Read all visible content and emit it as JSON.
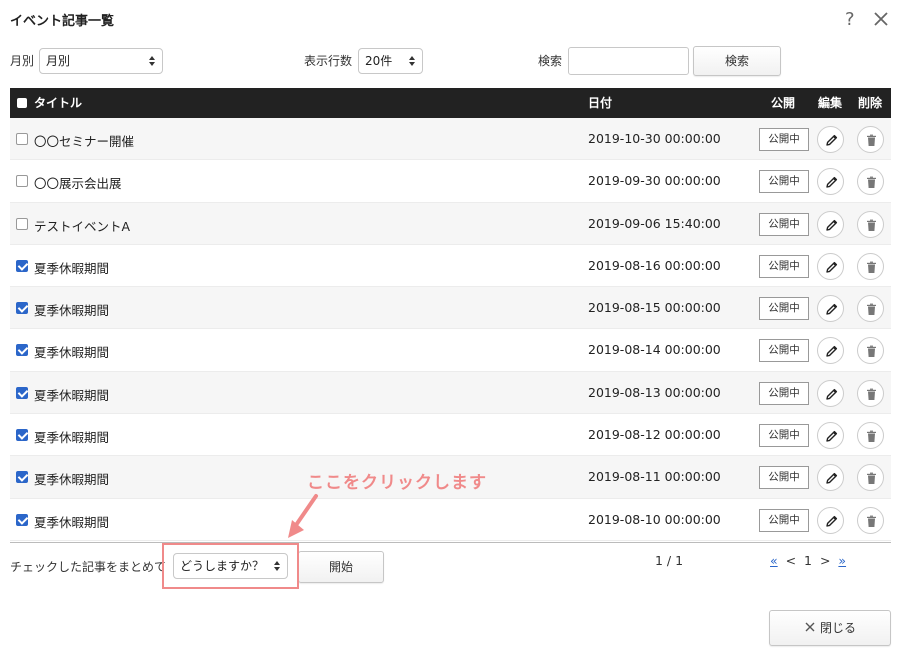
{
  "dialog": {
    "title": "イベント記事一覧",
    "help_glyph": "?",
    "close_icon": "close-x-icon"
  },
  "filters": {
    "month_label": "月別",
    "month_select_value": "月別",
    "rows_label": "表示行数",
    "rows_select_value": "20件",
    "search_label": "検索",
    "search_value": "",
    "search_button": "検索"
  },
  "table": {
    "headers": {
      "title": "タイトル",
      "date": "日付",
      "publish": "公開",
      "edit": "編集",
      "delete": "削除"
    },
    "rows": [
      {
        "title": "〇〇セミナー開催",
        "date": "2019-10-30 00:00:00",
        "checked": false,
        "status": "公開中"
      },
      {
        "title": "〇〇展示会出展",
        "date": "2019-09-30 00:00:00",
        "checked": false,
        "status": "公開中"
      },
      {
        "title": "テストイベントA",
        "date": "2019-09-06 15:40:00",
        "checked": false,
        "status": "公開中"
      },
      {
        "title": "夏季休暇期間",
        "date": "2019-08-16 00:00:00",
        "checked": true,
        "status": "公開中"
      },
      {
        "title": "夏季休暇期間",
        "date": "2019-08-15 00:00:00",
        "checked": true,
        "status": "公開中"
      },
      {
        "title": "夏季休暇期間",
        "date": "2019-08-14 00:00:00",
        "checked": true,
        "status": "公開中"
      },
      {
        "title": "夏季休暇期間",
        "date": "2019-08-13 00:00:00",
        "checked": true,
        "status": "公開中"
      },
      {
        "title": "夏季休暇期間",
        "date": "2019-08-12 00:00:00",
        "checked": true,
        "status": "公開中"
      },
      {
        "title": "夏季休暇期間",
        "date": "2019-08-11 00:00:00",
        "checked": true,
        "status": "公開中"
      },
      {
        "title": "夏季休暇期間",
        "date": "2019-08-10 00:00:00",
        "checked": true,
        "status": "公開中"
      }
    ]
  },
  "bulk": {
    "label": "チェックした記事をまとめて",
    "action_select_value": "どうしますか？",
    "start_button": "開始"
  },
  "annotation": {
    "text": "ここをクリックします",
    "color": "#f08a8a"
  },
  "pagination": {
    "info": "1 / 1",
    "first": "«",
    "prev": "<",
    "current": "1",
    "next": ">",
    "last": "»"
  },
  "footer": {
    "close_button": "閉じる"
  },
  "colors": {
    "header_bg": "#222222",
    "accent_blue": "#2b66c9",
    "row_alt": "#f6f6f6"
  }
}
